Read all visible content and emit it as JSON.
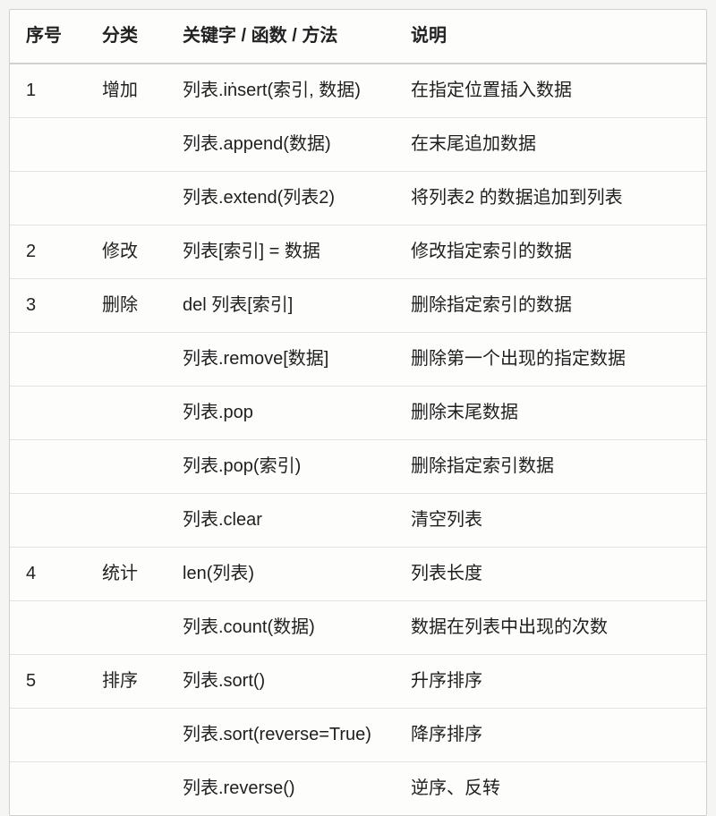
{
  "headers": {
    "num": "序号",
    "category": "分类",
    "keyword": "关键字 / 函数 / 方法",
    "desc": "说明"
  },
  "rows": [
    {
      "num": "1",
      "category": "增加",
      "keyword": "列表.iṅsert(索引, 数据)",
      "desc": "在指定位置插入数据"
    },
    {
      "num": "",
      "category": "",
      "keyword": "列表.append(数据)",
      "desc": "在末尾追加数据"
    },
    {
      "num": "",
      "category": "",
      "keyword": "列表.extend(列表2)",
      "desc": "将列表2 的数据追加到列表"
    },
    {
      "num": "2",
      "category": "修改",
      "keyword": "列表[索引] = 数据",
      "desc": "修改指定索引的数据"
    },
    {
      "num": "3",
      "category": "删除",
      "keyword": "del 列表[索引]",
      "desc": "删除指定索引的数据"
    },
    {
      "num": "",
      "category": "",
      "keyword": "列表.remove[数据]",
      "desc": "删除第一个出现的指定数据"
    },
    {
      "num": "",
      "category": "",
      "keyword": "列表.pop",
      "desc": "删除末尾数据"
    },
    {
      "num": "",
      "category": "",
      "keyword": "列表.pop(索引)",
      "desc": "删除指定索引数据"
    },
    {
      "num": "",
      "category": "",
      "keyword": "列表.clear",
      "desc": "清空列表"
    },
    {
      "num": "4",
      "category": "统计",
      "keyword": "len(列表)",
      "desc": "列表长度"
    },
    {
      "num": "",
      "category": "",
      "keyword": "列表.count(数据)",
      "desc": "数据在列表中出现的次数"
    },
    {
      "num": "5",
      "category": "排序",
      "keyword": "列表.sort()",
      "desc": "升序排序"
    },
    {
      "num": "",
      "category": "",
      "keyword": "列表.sort(reverse=True)",
      "desc": "降序排序"
    },
    {
      "num": "",
      "category": "",
      "keyword": "列表.reverse()",
      "desc": "逆序、反转"
    }
  ]
}
